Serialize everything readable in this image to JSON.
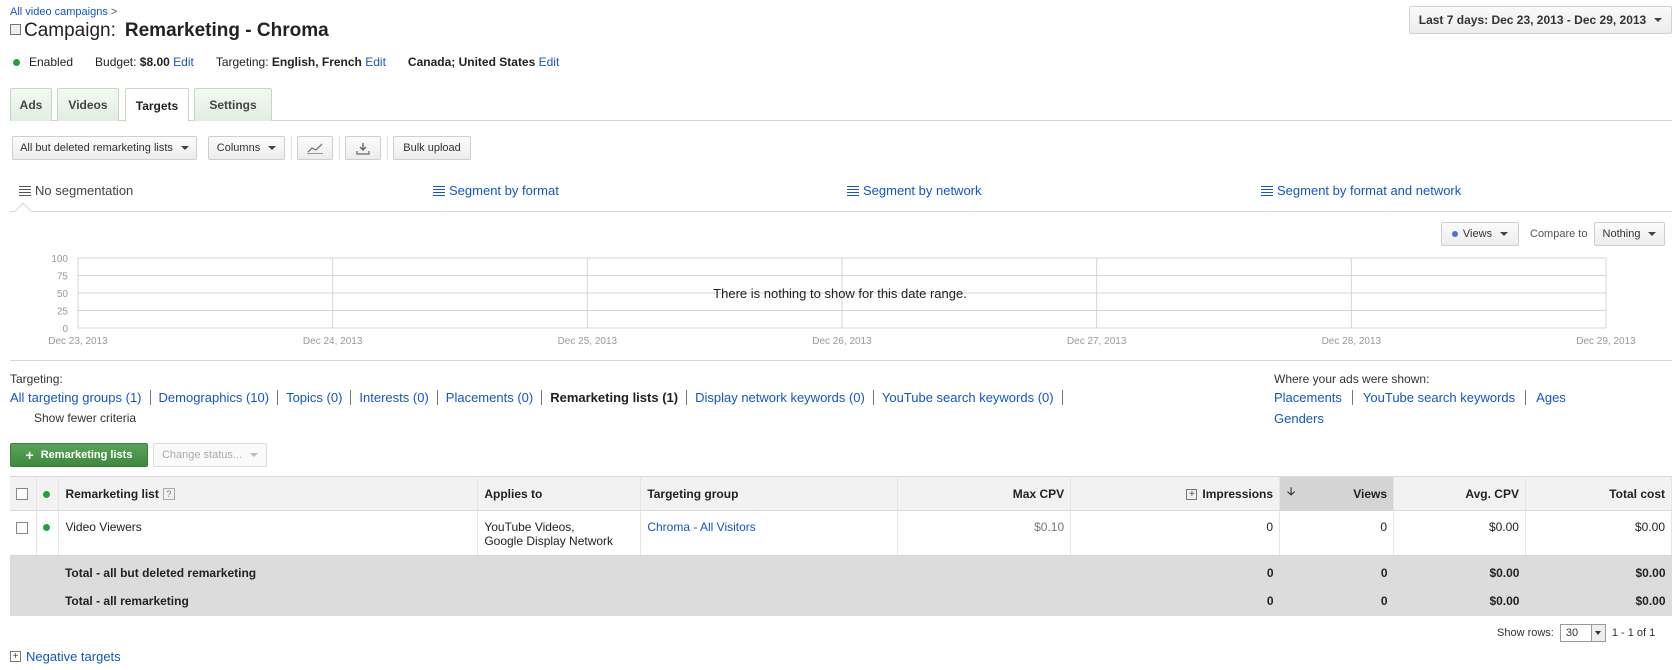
{
  "breadcrumb": {
    "link": "All video campaigns",
    "separator": ">"
  },
  "campaign": {
    "prefix": "Campaign:",
    "name": "Remarketing - Chroma",
    "status": "Enabled",
    "budget_label": "Budget:",
    "budget_value": "$8.00",
    "edit": "Edit",
    "targeting_label": "Targeting:",
    "targeting_langs": "English, French",
    "targeting_locations": "Canada; United States"
  },
  "date_range": "Last 7 days: Dec 23, 2013 - Dec 29, 2013",
  "tabs": [
    {
      "label": "Ads"
    },
    {
      "label": "Videos"
    },
    {
      "label": "Targets",
      "active": true
    },
    {
      "label": "Settings"
    }
  ],
  "toolbar": {
    "filter": "All but deleted remarketing lists",
    "columns": "Columns",
    "bulk_upload": "Bulk upload"
  },
  "segmentation": {
    "items": [
      "No segmentation",
      "Segment by format",
      "Segment by network",
      "Segment by format and network"
    ]
  },
  "chart_controls": {
    "metric": "Views",
    "compare_label": "Compare to",
    "compare_value": "Nothing"
  },
  "chart_data": {
    "type": "line",
    "ylabel": "Views",
    "ylim": [
      0,
      100
    ],
    "yticks": [
      "100",
      "75",
      "50",
      "25",
      "0"
    ],
    "x": [
      "Dec 23, 2013",
      "Dec 24, 2013",
      "Dec 25, 2013",
      "Dec 26, 2013",
      "Dec 27, 2013",
      "Dec 28, 2013",
      "Dec 29, 2013"
    ],
    "series": [],
    "grid": true,
    "empty_message": "There is nothing to show for this date range."
  },
  "targeting": {
    "label": "Targeting:",
    "links": [
      "All targeting groups (1)",
      "Demographics (10)",
      "Topics (0)",
      "Interests (0)",
      "Placements (0)",
      "Remarketing lists (1)",
      "Display network keywords (0)",
      "YouTube search keywords (0)"
    ],
    "current_index": 5,
    "show_fewer": "Show fewer criteria"
  },
  "where_shown": {
    "label": "Where your ads were shown:",
    "links": [
      "Placements",
      "YouTube search keywords",
      "Ages",
      "Genders"
    ]
  },
  "actions": {
    "add": "Remarketing lists",
    "change_status": "Change status..."
  },
  "table": {
    "headers": {
      "list": "Remarketing list",
      "applies": "Applies to",
      "group": "Targeting group",
      "max_cpv": "Max CPV",
      "impressions": "Impressions",
      "views": "Views",
      "avg_cpv": "Avg. CPV",
      "total_cost": "Total cost"
    },
    "rows": [
      {
        "name": "Video Viewers",
        "applies_line1": "YouTube Videos,",
        "applies_line2": "Google Display Network",
        "group": "Chroma - All Visitors",
        "max_cpv": "$0.10",
        "impressions": "0",
        "views": "0",
        "avg_cpv": "$0.00",
        "total_cost": "$0.00"
      }
    ],
    "totals": [
      {
        "label": "Total - all but deleted remarketing",
        "impressions": "0",
        "views": "0",
        "avg_cpv": "$0.00",
        "total_cost": "$0.00"
      },
      {
        "label": "Total - all remarketing",
        "impressions": "0",
        "views": "0",
        "avg_cpv": "$0.00",
        "total_cost": "$0.00"
      }
    ]
  },
  "pagination": {
    "show_rows_label": "Show rows:",
    "rows": "30",
    "range": "1 - 1 of 1"
  },
  "negative_targets": "Negative targets",
  "colors": {
    "link": "#1155cc",
    "enabled": "#21a13c",
    "primary_button": "#4a964a"
  }
}
